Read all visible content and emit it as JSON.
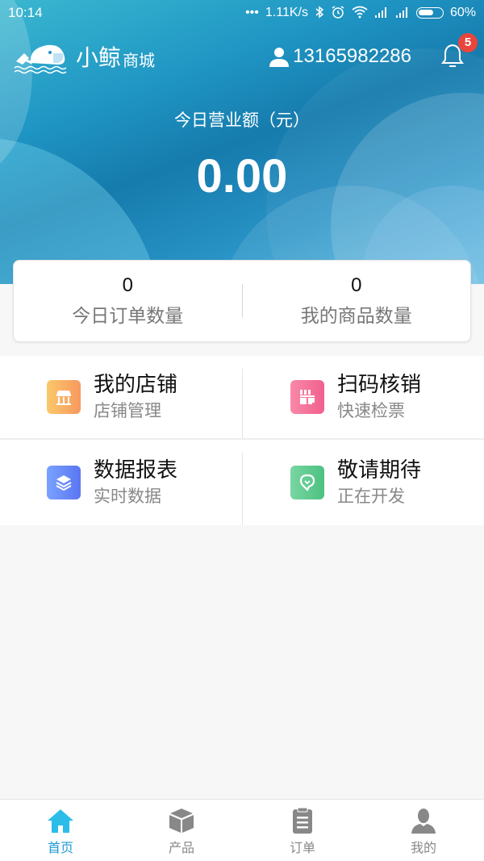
{
  "status_bar": {
    "time": "10:14",
    "dots": "•••",
    "network_speed": "1.11K/s",
    "icons": [
      "bluetooth-icon",
      "alarm-icon",
      "wifi-icon",
      "signal-icon",
      "signal-icon",
      "battery-icon"
    ],
    "battery": "60%"
  },
  "header": {
    "logo_big": "小鲸",
    "logo_small": "商城",
    "user_phone": "13165982286",
    "notification_count": "5"
  },
  "revenue": {
    "label": "今日营业额（元）",
    "value": "0.00"
  },
  "stats": [
    {
      "value": "0",
      "label": "今日订单数量"
    },
    {
      "value": "0",
      "label": "我的商品数量"
    }
  ],
  "features": [
    {
      "title": "我的店铺",
      "subtitle": "店铺管理",
      "icon": "store-icon",
      "color": "#f9a862"
    },
    {
      "title": "扫码核销",
      "subtitle": "快速检票",
      "icon": "scan-icon",
      "color": "#f4709a"
    },
    {
      "title": "数据报表",
      "subtitle": "实时数据",
      "icon": "layers-icon",
      "color": "#6888f6"
    },
    {
      "title": "敬请期待",
      "subtitle": "正在开发",
      "icon": "location-icon",
      "color": "#5fca8f"
    }
  ],
  "tabs": [
    {
      "label": "首页",
      "icon": "home-icon",
      "active": true
    },
    {
      "label": "产品",
      "icon": "box-icon",
      "active": false
    },
    {
      "label": "订单",
      "icon": "clipboard-icon",
      "active": false
    },
    {
      "label": "我的",
      "icon": "person-icon",
      "active": false
    }
  ],
  "colors": {
    "accent": "#1e9ad6",
    "badge": "#e8453c",
    "tab_inactive": "#888888"
  }
}
